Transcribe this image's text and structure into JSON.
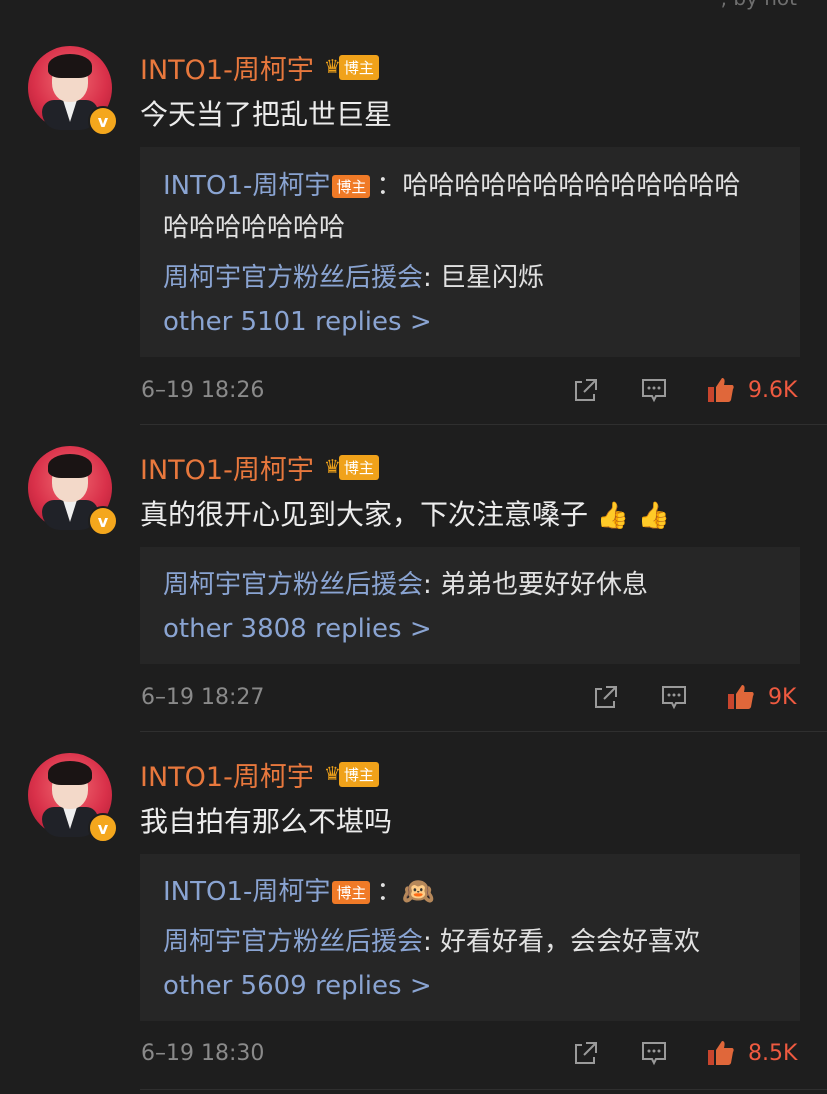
{
  "top_partial": ", by hot",
  "comments": [
    {
      "username": "INTO1-周柯宇",
      "badge": "博主",
      "text": "今天当了把乱世巨星",
      "replies": [
        {
          "user": "INTO1-周柯宇",
          "badge": "博主",
          "text_line1": "：哈哈哈哈哈哈哈哈哈哈哈哈哈",
          "text_line2": "哈哈哈哈哈哈哈"
        },
        {
          "user": "周柯宇官方粉丝后援会",
          "text": ": 巨星闪烁"
        }
      ],
      "more": "other 5101 replies >",
      "time": "6–19 18:26",
      "likes": "9.6K"
    },
    {
      "username": "INTO1-周柯宇",
      "badge": "博主",
      "text": "真的很开心见到大家，下次注意嗓子",
      "emoji": "👍 👍",
      "replies": [
        {
          "user": "周柯宇官方粉丝后援会",
          "text": ": 弟弟也要好好休息"
        }
      ],
      "more": "other 3808 replies >",
      "time": "6–19 18:27",
      "likes": "9K"
    },
    {
      "username": "INTO1-周柯宇",
      "badge": "博主",
      "text": "我自拍有那么不堪吗",
      "replies": [
        {
          "user": "INTO1-周柯宇",
          "badge": "博主",
          "text": "：🙉"
        },
        {
          "user": "周柯宇官方粉丝后援会",
          "text": ": 好看好看，会会好喜欢"
        }
      ],
      "more": "other 5609 replies >",
      "time": "6–19 18:30",
      "likes": "8.5K"
    }
  ],
  "icons": {
    "share": "share-icon",
    "comment": "comment-icon",
    "like": "thumbs-up-icon"
  },
  "colors": {
    "username": "#e8783d",
    "reply_user": "#8aa4d2",
    "likes": "#ef5a40",
    "badge": "#f0a21a"
  }
}
